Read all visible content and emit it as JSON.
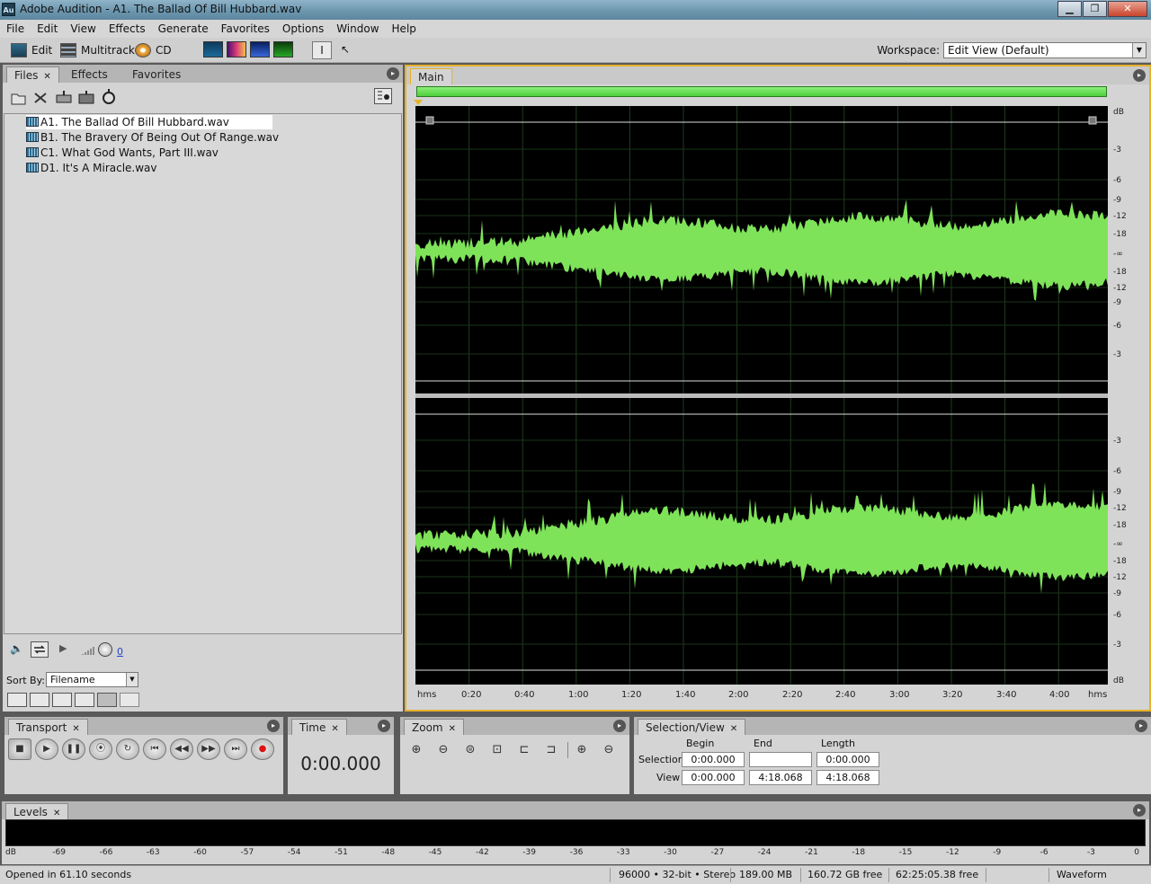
{
  "window": {
    "title": "Adobe Audition - A1. The Ballad Of Bill Hubbard.wav",
    "app_icon": "Au",
    "buttons": [
      "minimize-icon",
      "maximize-icon",
      "close-icon"
    ]
  },
  "menubar": [
    "File",
    "Edit",
    "View",
    "Effects",
    "Generate",
    "Favorites",
    "Options",
    "Window",
    "Help"
  ],
  "toolbar": {
    "edit_label": "Edit",
    "multitrack_label": "Multitrack",
    "cd_label": "CD",
    "workspace_label": "Workspace:",
    "workspace_value": "Edit View (Default)"
  },
  "files_panel": {
    "tabs": [
      "Files",
      "Effects",
      "Favorites"
    ],
    "active_tab": "Files",
    "files": [
      "A1. The Ballad Of Bill Hubbard.wav",
      "B1. The Bravery Of Being Out Of Range.wav",
      "C1. What God Wants, Part III.wav",
      "D1. It's A Miracle.wav"
    ],
    "selected_index": 0,
    "volume_value": "0",
    "sort_by_label": "Sort By:",
    "sort_by_value": "Filename"
  },
  "editor": {
    "tab": "Main",
    "waveform_color": "#7fe35a",
    "db_scale_top": [
      "dB",
      "-3",
      "-6",
      "-9",
      "-12",
      "-18",
      "-∞",
      "-18",
      "-12",
      "-9",
      "-6",
      "-3"
    ],
    "db_scale_bottom": [
      "-3",
      "-6",
      "-9",
      "-12",
      "-18",
      "-∞",
      "-18",
      "-12",
      "-9",
      "-6",
      "-3",
      "dB"
    ],
    "time_ruler": [
      "hms",
      "0:20",
      "0:40",
      "1:00",
      "1:20",
      "1:40",
      "2:00",
      "2:20",
      "2:40",
      "3:00",
      "3:20",
      "3:40",
      "4:00",
      "hms"
    ]
  },
  "transport": {
    "title": "Transport",
    "buttons": [
      "stop-icon",
      "play-icon",
      "pause-icon",
      "play-from-cursor-icon",
      "loop-icon",
      "go-to-start-icon",
      "rewind-icon",
      "fast-forward-icon",
      "go-to-end-icon",
      "record-icon"
    ]
  },
  "time_panel": {
    "title": "Time",
    "value": "0:00.000"
  },
  "zoom_panel": {
    "title": "Zoom"
  },
  "selection_view": {
    "title": "Selection/View",
    "headers": [
      "Begin",
      "End",
      "Length"
    ],
    "selection_label": "Selection",
    "view_label": "View",
    "selection": {
      "begin": "0:00.000",
      "end": "",
      "length": "0:00.000"
    },
    "view": {
      "begin": "0:00.000",
      "end": "4:18.068",
      "length": "4:18.068"
    }
  },
  "levels": {
    "title": "Levels",
    "ticks": [
      "dB",
      "-69",
      "-66",
      "-63",
      "-60",
      "-57",
      "-54",
      "-51",
      "-48",
      "-45",
      "-42",
      "-39",
      "-36",
      "-33",
      "-30",
      "-27",
      "-24",
      "-21",
      "-18",
      "-15",
      "-12",
      "-9",
      "-6",
      "-3",
      "0"
    ]
  },
  "statusbar": {
    "message": "Opened in 61.10 seconds",
    "format": "96000 • 32-bit • Stereo",
    "size": "189.00 MB",
    "disk_free": "160.72 GB free",
    "time_free": "62:25:05.38 free",
    "view_mode": "Waveform"
  }
}
